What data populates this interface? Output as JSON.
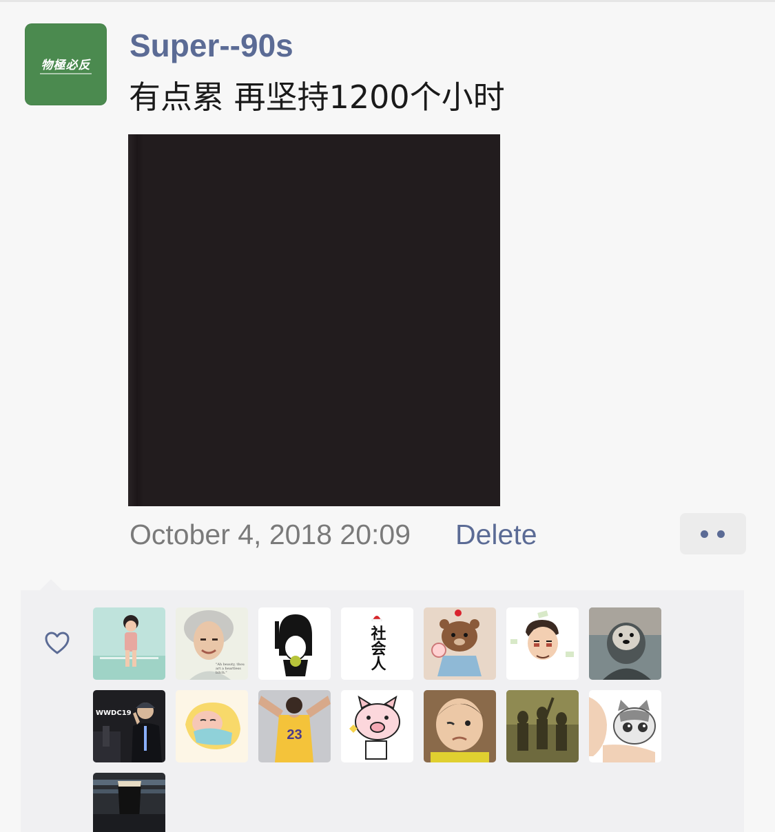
{
  "post": {
    "avatar": {
      "logo_text": "物極必反",
      "bg_color": "#4b8a4f"
    },
    "username": "Super--90s",
    "text": "有点累 再坚持1200个小时",
    "image": {
      "bg_color": "#221c1e"
    },
    "timestamp": "October 4, 2018 20:09",
    "delete_label": "Delete",
    "more_icon": "more-dots-icon"
  },
  "likes": {
    "icon": "heart-outline-icon",
    "link_color": "#5b6b95",
    "avatars": [
      {
        "name": "liker-avatar-child",
        "bg": "#bfe3dc"
      },
      {
        "name": "liker-avatar-einstein",
        "bg": "#eef0e6",
        "caption": "\"Ah beauty, thou art a heartless bitch.\""
      },
      {
        "name": "liker-avatar-cartoon-girl",
        "bg": "#ffffff"
      },
      {
        "name": "liker-avatar-shehuiren",
        "bg": "#ffffff",
        "text": "社会人"
      },
      {
        "name": "liker-avatar-bear",
        "bg": "#e8d7c8"
      },
      {
        "name": "liker-avatar-cartoon-man",
        "bg": "#ffffff"
      },
      {
        "name": "liker-avatar-otter",
        "bg": "#7d8a8c"
      },
      {
        "name": "liker-avatar-wwdc",
        "bg": "#1e1e22",
        "label": "WWDC19"
      },
      {
        "name": "liker-avatar-sleeping-cartoon",
        "bg": "#fdf6e6"
      },
      {
        "name": "liker-avatar-jersey",
        "bg": "#c8c9cd",
        "label": "23"
      },
      {
        "name": "liker-avatar-pig",
        "bg": "#ffffff"
      },
      {
        "name": "liker-avatar-baby",
        "bg": "#8a6a4a"
      },
      {
        "name": "liker-avatar-shadows",
        "bg": "#6e6a3e"
      },
      {
        "name": "liker-avatar-cat",
        "bg": "#ffffff"
      },
      {
        "name": "liker-avatar-beer",
        "bg": "#2b2e33"
      }
    ]
  }
}
